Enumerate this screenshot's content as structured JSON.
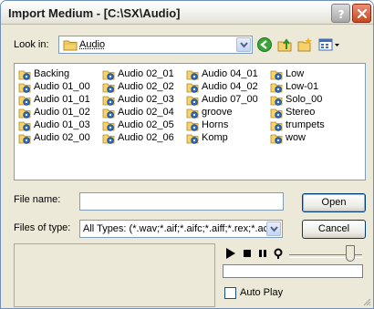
{
  "window": {
    "title": "Import Medium - [C:\\SX\\Audio]"
  },
  "look_in": {
    "label": "Look in:",
    "value": "Audio"
  },
  "toolbar_icons": [
    "back-icon",
    "up-folder-icon",
    "new-folder-icon",
    "view-menu-icon"
  ],
  "files": [
    [
      "Backing",
      "Audio 01_00",
      "Audio 01_01",
      "Audio 01_02",
      "Audio 01_03",
      "Audio 02_00"
    ],
    [
      "Audio 02_01",
      "Audio 02_02",
      "Audio 02_03",
      "Audio 02_04",
      "Audio 02_05",
      "Audio 02_06"
    ],
    [
      "Audio 04_01",
      "Audio 04_02",
      "Audio 07_00",
      "groove",
      "Horns",
      "Komp"
    ],
    [
      "Low",
      "Low-01",
      "Solo_00",
      "Stereo",
      "trumpets",
      "wow"
    ]
  ],
  "file_name": {
    "label": "File name:",
    "value": "",
    "open_label": "Open"
  },
  "file_type": {
    "label": "Files of type:",
    "value": "All Types: (*.wav;*.aif;*.aifc;*.aiff;*.rex;*.ac3;*",
    "cancel_label": "Cancel"
  },
  "auto_play": {
    "label": "Auto Play",
    "checked": false
  },
  "colors": {
    "title_bar": "#f3f3f0",
    "close_button": "#c9481f",
    "dialog_bg": "#ece9d8",
    "field_border": "#7f9db9",
    "folder_yellow": "#f5d26a"
  }
}
